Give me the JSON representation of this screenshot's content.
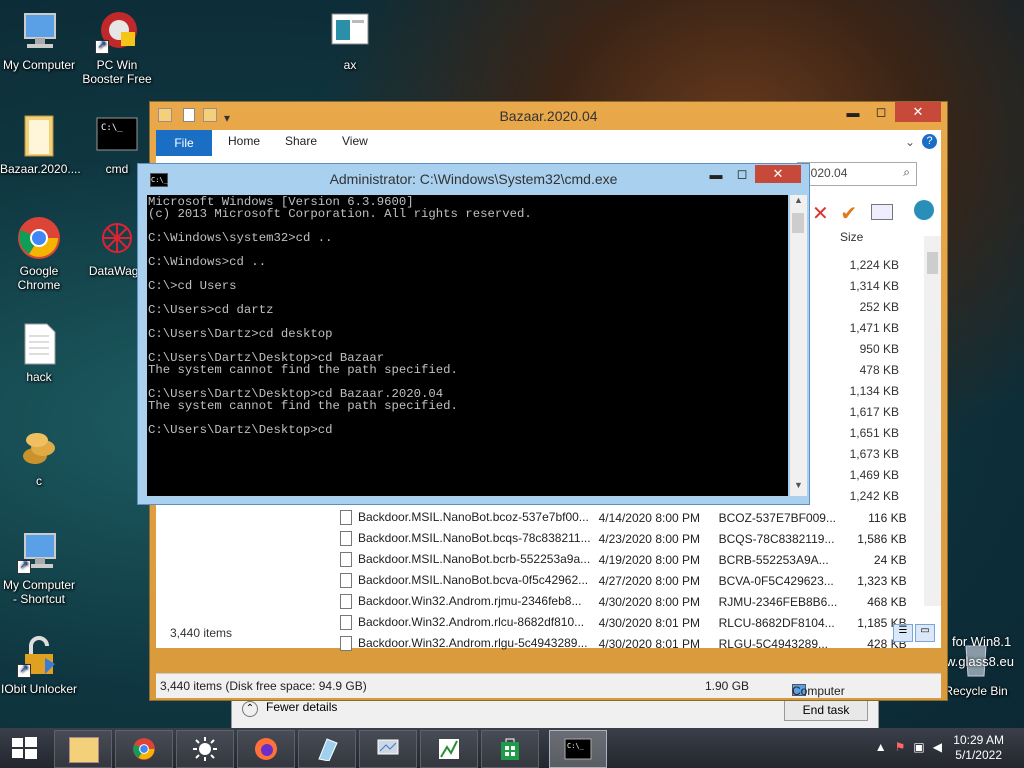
{
  "desktop": {
    "icons": [
      {
        "label": "My Computer"
      },
      {
        "label": "PC Win Booster Free"
      },
      {
        "label": "ax"
      },
      {
        "label": "Bazaar.2020...."
      },
      {
        "label": "cmd"
      },
      {
        "label": "Google Chrome"
      },
      {
        "label": "DataWago"
      },
      {
        "label": "hack"
      },
      {
        "label": "c"
      },
      {
        "label": "My Computer - Shortcut"
      },
      {
        "label": "IObit Unlocker"
      },
      {
        "label": "Recycle Bin"
      }
    ],
    "watermark_line1": "for Win8.1",
    "watermark_line2": "w.glass8.eu"
  },
  "explorer": {
    "title": "Bazaar.2020.04",
    "tabs": {
      "file": "File",
      "home": "Home",
      "share": "Share",
      "view": "View"
    },
    "search_value": "2020.04",
    "size_header": "Size",
    "sizes": [
      "1,224 KB",
      "1,314 KB",
      "252 KB",
      "1,471 KB",
      "950 KB",
      "478 KB",
      "1,134 KB",
      "1,617 KB",
      "1,651 KB",
      "1,673 KB",
      "1,469 KB",
      "1,242 KB"
    ],
    "rows": [
      {
        "name": "Backdoor.MSIL.NanoBot.bcoz-537e7bf00...",
        "date": "4/14/2020 8:00 PM",
        "type": "BCOZ-537E7BF009...",
        "size": "116 KB"
      },
      {
        "name": "Backdoor.MSIL.NanoBot.bcqs-78c838211...",
        "date": "4/23/2020 8:00 PM",
        "type": "BCQS-78C8382119...",
        "size": "1,586 KB"
      },
      {
        "name": "Backdoor.MSIL.NanoBot.bcrb-552253a9a...",
        "date": "4/19/2020 8:00 PM",
        "type": "BCRB-552253A9A...",
        "size": "24 KB"
      },
      {
        "name": "Backdoor.MSIL.NanoBot.bcva-0f5c42962...",
        "date": "4/27/2020 8:00 PM",
        "type": "BCVA-0F5C429623...",
        "size": "1,323 KB"
      },
      {
        "name": "Backdoor.Win32.Androm.rjmu-2346feb8...",
        "date": "4/30/2020 8:00 PM",
        "type": "RJMU-2346FEB8B6...",
        "size": "468 KB"
      },
      {
        "name": "Backdoor.Win32.Androm.rlcu-8682df810...",
        "date": "4/30/2020 8:01 PM",
        "type": "RLCU-8682DF8104...",
        "size": "1,185 KB"
      },
      {
        "name": "Backdoor.Win32.Androm.rlgu-5c4943289...",
        "date": "4/30/2020 8:01 PM",
        "type": "RLGU-5C4943289...",
        "size": "428 KB"
      }
    ],
    "item_count": "3,440 items",
    "status_left": "3,440 items (Disk free space: 94.9 GB)",
    "status_size": "1.90 GB",
    "status_location": "Computer"
  },
  "taskmgr": {
    "fewer_details": "Fewer details",
    "end_task": "End task"
  },
  "cmd": {
    "title": "Administrator: C:\\Windows\\System32\\cmd.exe",
    "icon_text": "C:\\_",
    "output": "Microsoft Windows [Version 6.3.9600]\n(c) 2013 Microsoft Corporation. All rights reserved.\n\nC:\\Windows\\system32>cd ..\n\nC:\\Windows>cd ..\n\nC:\\>cd Users\n\nC:\\Users>cd dartz\n\nC:\\Users\\Dartz>cd desktop\n\nC:\\Users\\Dartz\\Desktop>cd Bazaar\nThe system cannot find the path specified.\n\nC:\\Users\\Dartz\\Desktop>cd Bazaar.2020.04\nThe system cannot find the path specified.\n\nC:\\Users\\Dartz\\Desktop>cd"
  },
  "taskbar": {
    "time": "10:29 AM",
    "date": "5/1/2022"
  }
}
